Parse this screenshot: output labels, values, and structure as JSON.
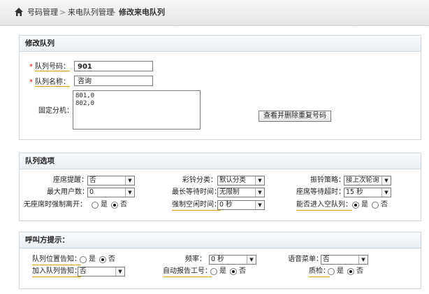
{
  "breadcrumb": {
    "items": [
      "号码管理",
      "来电队列管理",
      "修改来电队列"
    ],
    "separator": ">"
  },
  "edit_panel": {
    "title": "修改队列",
    "queue_no_label": "队列号码：",
    "queue_no_value": "901",
    "queue_name_label": "队列名称：",
    "queue_name_value": "咨询",
    "extensions_label": "固定分机：",
    "extensions_value": "801,0\n802,0",
    "dedupe_button": "查看并删除重复号码"
  },
  "options_panel": {
    "title": "队列选项",
    "seat_remind_label": "座席提醒：",
    "seat_remind_value": "否",
    "ringback_label": "彩铃分类：",
    "ringback_value": "默认分类",
    "ring_strategy_label": "振铃策略：",
    "ring_strategy_value": "接上次轮询",
    "max_users_label": "最大用户数：",
    "max_users_value": "0",
    "max_wait_label": "最长等待时间：",
    "max_wait_value": "无限制",
    "seat_timeout_label": "座席等待超时：",
    "seat_timeout_value": "15 秒",
    "no_seat_leave_label": "无座席时强制离开：",
    "no_seat_leave_value": "否",
    "force_idle_label": "强制空闲时间：",
    "force_idle_value": "0 秒",
    "empty_queue_label": "能否进入空队列：",
    "empty_queue_value": "是"
  },
  "prompt_panel": {
    "title": "呼叫方提示：",
    "position_notify_label": "队列位置告知：",
    "position_notify_value": "否",
    "frequency_label": "频率：",
    "frequency_value": "0 秒",
    "voice_menu_label": "语音菜单：",
    "voice_menu_value": "否",
    "join_notify_label": "加入队列告知：",
    "join_notify_value": "否",
    "auto_report_label": "自动报告工号：",
    "auto_report_value": "否",
    "qa_label": "质检：",
    "qa_value": "否"
  },
  "radio_labels": {
    "yes": "是",
    "no": "否"
  },
  "icons": {
    "home": "home-icon",
    "dropdown": "chevron-down-icon"
  }
}
